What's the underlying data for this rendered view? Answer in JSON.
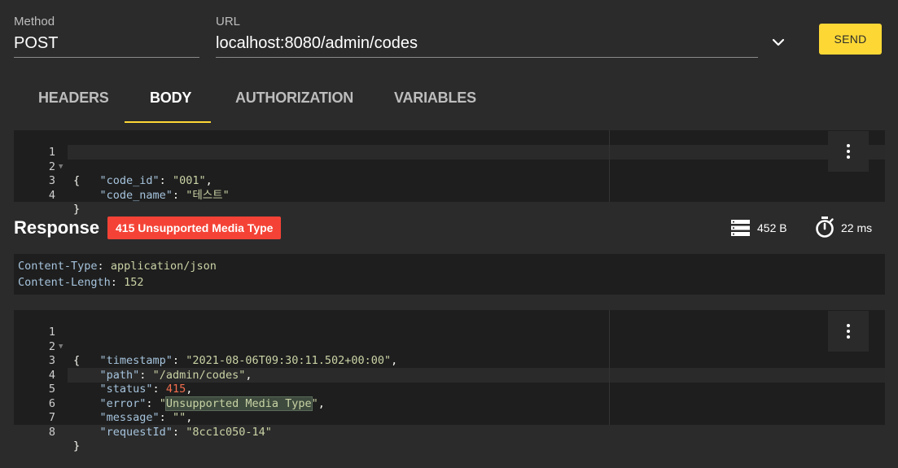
{
  "request": {
    "method_label": "Method",
    "method_value": "POST",
    "url_label": "URL",
    "url_value": "localhost:8080/admin/codes",
    "send_label": "SEND"
  },
  "tabs": [
    {
      "label": "HEADERS",
      "active": false
    },
    {
      "label": "BODY",
      "active": true
    },
    {
      "label": "AUTHORIZATION",
      "active": false
    },
    {
      "label": "VARIABLES",
      "active": false
    }
  ],
  "body_editor": {
    "lines": [
      {
        "num": "1",
        "fold": "▼",
        "text": "{"
      },
      {
        "num": "2",
        "key": "\"code_id\"",
        "value": "\"001\"",
        "trail": ","
      },
      {
        "num": "3",
        "key": "\"code_name\"",
        "value": "\"테스트\"",
        "trail": ""
      },
      {
        "num": "4",
        "text": "}"
      }
    ]
  },
  "response": {
    "title": "Response",
    "status_badge": "415 Unsupported Media Type",
    "size": "452 B",
    "time": "22 ms",
    "headers": [
      {
        "name": "Content-Type",
        "value": "application/json"
      },
      {
        "name": "Content-Length",
        "value": "152"
      }
    ],
    "body_lines": [
      {
        "num": "1",
        "fold": "▼",
        "text": "{"
      },
      {
        "num": "2",
        "key": "\"timestamp\"",
        "value": "\"2021-08-06T09:30:11.502+00:00\"",
        "trail": ","
      },
      {
        "num": "3",
        "key": "\"path\"",
        "value": "\"/admin/codes\"",
        "trail": ","
      },
      {
        "num": "4",
        "key": "\"status\"",
        "value": "415",
        "trail": ","
      },
      {
        "num": "5",
        "key": "\"error\"",
        "value_q1": "\"",
        "value_sel": "Unsupported Media Type",
        "value_q2": "\"",
        "trail": ","
      },
      {
        "num": "6",
        "key": "\"message\"",
        "value": "\"\"",
        "trail": ","
      },
      {
        "num": "7",
        "key": "\"requestId\"",
        "value": "\"8cc1c050-14\"",
        "trail": ""
      },
      {
        "num": "8",
        "text": "}"
      }
    ]
  },
  "icons": {
    "chevron": "chevron-down-icon",
    "more": "more-vert-icon",
    "size": "storage-icon",
    "time": "timer-icon"
  },
  "colors": {
    "accent": "#fdd835",
    "error_badge": "#f44336",
    "background": "#2b2b2b",
    "editor_bg": "#1e1e1e"
  }
}
